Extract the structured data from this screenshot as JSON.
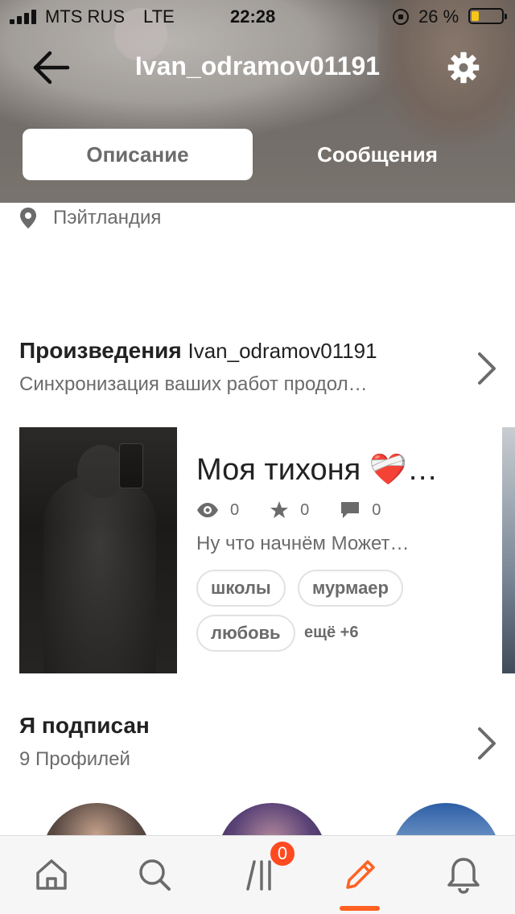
{
  "status_bar": {
    "carrier": "MTS RUS",
    "network": "LTE",
    "time": "22:28",
    "battery_percent": "26 %",
    "battery_level": 0.26
  },
  "header": {
    "title": "Ivan_odramov01191",
    "back_icon": "arrow-left-icon",
    "settings_icon": "gear-icon"
  },
  "tabs": {
    "description": "Описание",
    "messages": "Сообщения",
    "active": "description"
  },
  "profile": {
    "location": "Пэйтландия"
  },
  "works": {
    "title": "Произведения",
    "username": "Ivan_odramov01191",
    "subtitle": "Синхронизация ваших работ продол…",
    "story": {
      "title": "Моя тихоня ❤️‍🩹…",
      "views": "0",
      "votes": "0",
      "comments": "0",
      "description": "Ну что начнём  Может…",
      "tags": [
        "школы",
        "мурмаер",
        "любовь"
      ],
      "more_tags": "ещё +6"
    }
  },
  "following": {
    "title": "Я подписан",
    "subtitle": "9 Профилей"
  },
  "tabbar": {
    "items": [
      "home-icon",
      "search-icon",
      "library-icon",
      "write-icon",
      "bell-icon"
    ],
    "library_badge": "0",
    "active": "write-icon"
  },
  "colors": {
    "accent": "#ff6122",
    "badge": "#ff4a20",
    "text_primary": "#222222",
    "text_secondary": "#6b6b6b"
  }
}
